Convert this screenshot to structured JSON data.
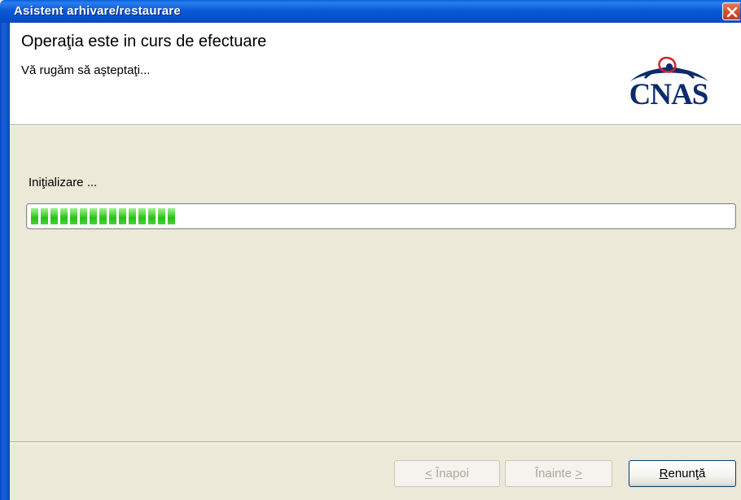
{
  "window": {
    "title": "Asistent arhivare/restaurare"
  },
  "header": {
    "title": "Operaţia este in curs de efectuare",
    "subtitle": "Vă rugăm să aşteptaţi...",
    "logo_text": "CNAS"
  },
  "status": {
    "label": "Iniţializare ...",
    "progress_percent": 21,
    "progress_color": "#27c214"
  },
  "buttons": {
    "back": {
      "label": "< Înapoi",
      "enabled": false
    },
    "next": {
      "label": "Înainte >",
      "enabled": false
    },
    "cancel": {
      "label": "Renunţă",
      "enabled": true
    }
  },
  "icons": {
    "close": "close-icon",
    "logo": "cnas-logo-icon"
  }
}
